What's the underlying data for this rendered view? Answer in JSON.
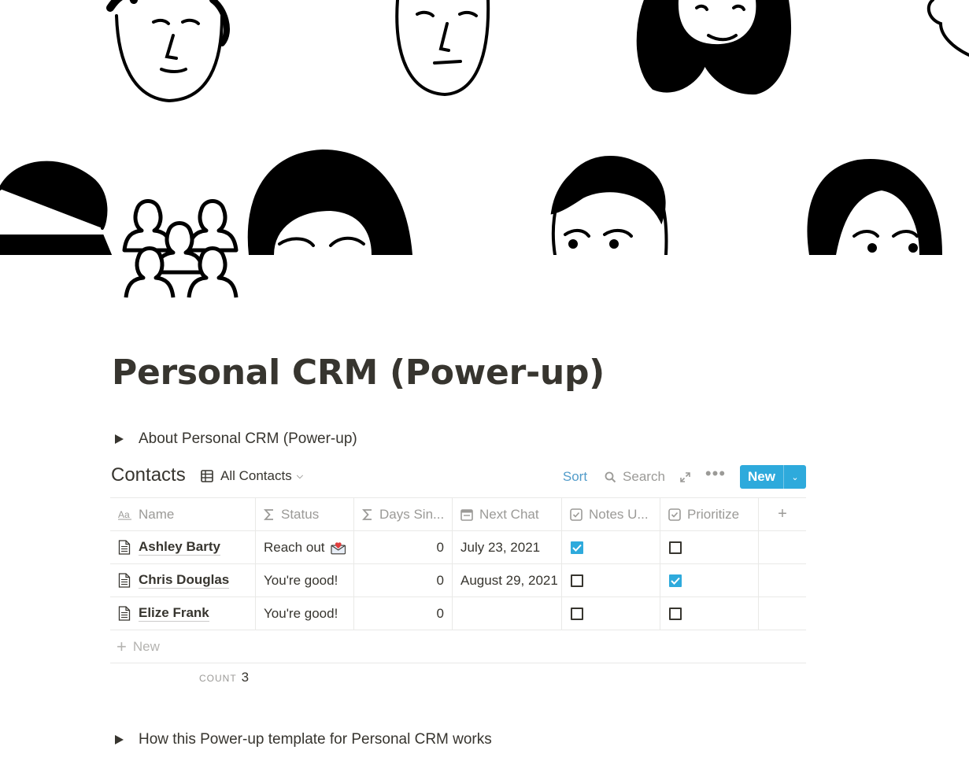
{
  "page": {
    "title": "Personal CRM (Power-up)",
    "toggle_about": "About Personal CRM (Power-up)",
    "toggle_how": "How this Power-up template for Personal CRM works"
  },
  "database": {
    "title": "Contacts",
    "view_name": "All Contacts",
    "toolbar": {
      "sort": "Sort",
      "search": "Search",
      "new": "New"
    },
    "columns": [
      {
        "label": "Name",
        "icon": "text-aa-icon"
      },
      {
        "label": "Status",
        "icon": "formula-sigma-icon"
      },
      {
        "label": "Days Sin...",
        "icon": "formula-sigma-icon"
      },
      {
        "label": "Next Chat",
        "icon": "calendar-icon"
      },
      {
        "label": "Notes U...",
        "icon": "checkbox-icon"
      },
      {
        "label": "Prioritize",
        "icon": "checkbox-icon"
      }
    ],
    "rows": [
      {
        "name": "Ashley Barty",
        "status": "Reach out",
        "status_icon": "envelope-heart-icon",
        "days": "0",
        "next_chat": "July 23, 2021",
        "notes_updated": true,
        "prioritize": false
      },
      {
        "name": "Chris Douglas",
        "status": "You're good!",
        "days": "0",
        "next_chat": "August 29, 2021",
        "notes_updated": false,
        "prioritize": true
      },
      {
        "name": "Elize Frank",
        "status": "You're good!",
        "days": "0",
        "next_chat": "",
        "notes_updated": false,
        "prioritize": false
      }
    ],
    "new_row_label": "New",
    "count_label": "COUNT",
    "count_value": "3"
  },
  "colors": {
    "accent": "#2eaadc",
    "sort_link": "#529cca",
    "text": "#37352f",
    "muted": "#9b9a97"
  }
}
